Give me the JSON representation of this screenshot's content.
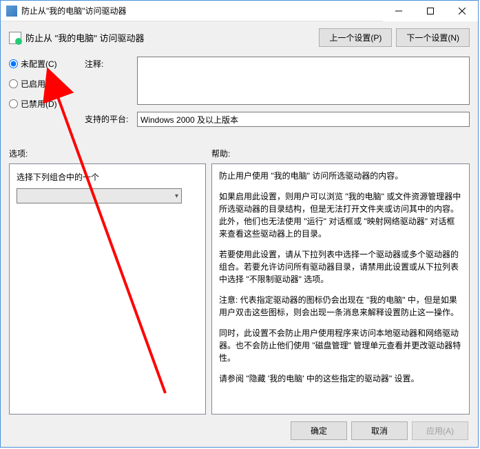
{
  "window": {
    "title": "防止从\"我的电脑\"访问驱动器"
  },
  "header": {
    "policy_title": "防止从 \"我的电脑\" 访问驱动器",
    "prev_btn": "上一个设置(P)",
    "next_btn": "下一个设置(N)"
  },
  "radios": {
    "not_configured": "未配置(C)",
    "enabled": "已启用(E)",
    "disabled": "已禁用(D)"
  },
  "fields": {
    "comment_label": "注释:",
    "comment_value": "",
    "platform_label": "支持的平台:",
    "platform_value": "Windows 2000 及以上版本"
  },
  "mid": {
    "options_label": "选项:",
    "help_label": "帮助:"
  },
  "options": {
    "prompt": "选择下列组合中的一个",
    "selected": ""
  },
  "help": {
    "p1": "防止用户使用 \"我的电脑\" 访问所选驱动器的内容。",
    "p2": "如果启用此设置，则用户可以浏览 \"我的电脑\" 或文件资源管理器中所选驱动器的目录结构，但是无法打开文件夹或访问其中的内容。此外，他们也无法使用 \"运行\" 对话框或 \"映射网络驱动器\" 对话框来查看这些驱动器上的目录。",
    "p3": "若要使用此设置，请从下拉列表中选择一个驱动器或多个驱动器的组合。若要允许访问所有驱动器目录，请禁用此设置或从下拉列表中选择 \"不限制驱动器\" 选项。",
    "p4": "注意: 代表指定驱动器的图标仍会出现在 \"我的电脑\" 中，但是如果用户双击这些图标，则会出现一条消息来解释设置防止这一操作。",
    "p5": "同时，此设置不会防止用户使用程序来访问本地驱动器和网络驱动器。也不会防止他们使用 \"磁盘管理\" 管理单元查看并更改驱动器特性。",
    "p6": "请参阅 \"隐藏 '我的电脑' 中的这些指定的驱动器\" 设置。"
  },
  "footer": {
    "ok": "确定",
    "cancel": "取消",
    "apply": "应用(A)"
  }
}
